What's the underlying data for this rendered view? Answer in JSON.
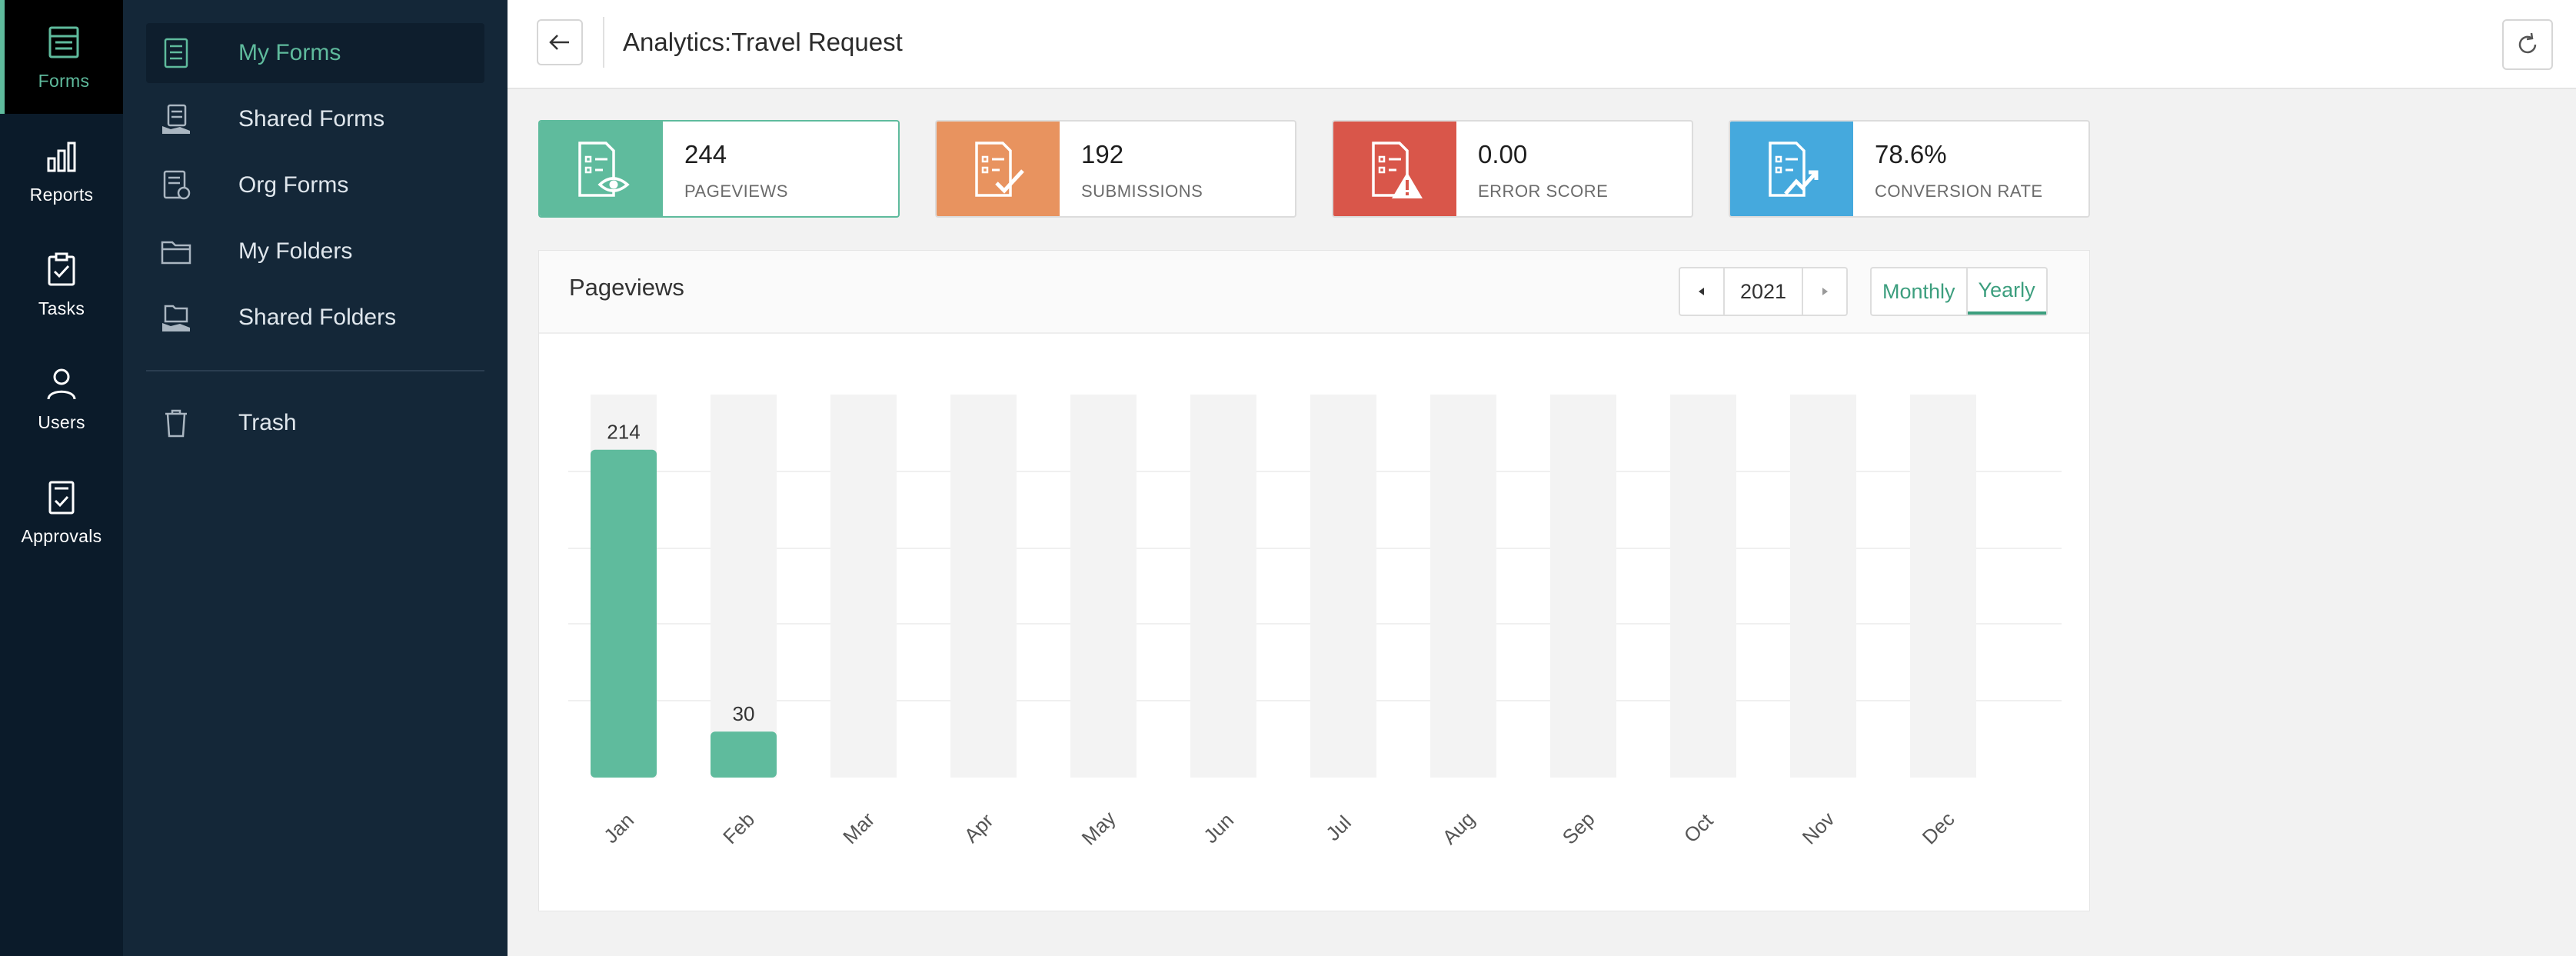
{
  "rail": [
    {
      "label": "Forms",
      "icon": "forms-icon",
      "active": true
    },
    {
      "label": "Reports",
      "icon": "reports-icon",
      "active": false
    },
    {
      "label": "Tasks",
      "icon": "tasks-icon",
      "active": false
    },
    {
      "label": "Users",
      "icon": "users-icon",
      "active": false
    },
    {
      "label": "Approvals",
      "icon": "approvals-icon",
      "active": false
    }
  ],
  "nav": [
    {
      "label": "My Forms",
      "icon": "form-doc-icon",
      "active": true
    },
    {
      "label": "Shared Forms",
      "icon": "shared-forms-icon",
      "active": false
    },
    {
      "label": "Org Forms",
      "icon": "org-forms-icon",
      "active": false
    },
    {
      "label": "My Folders",
      "icon": "folder-icon",
      "active": false
    },
    {
      "label": "Shared Folders",
      "icon": "shared-folder-icon",
      "active": false
    },
    {
      "label": "Trash",
      "icon": "trash-icon",
      "active": false
    }
  ],
  "header": {
    "title": "Analytics:Travel Request"
  },
  "stats": [
    {
      "value": "244",
      "label": "PAGEVIEWS",
      "color": "#5fbb9d",
      "icon": "pageviews-icon"
    },
    {
      "value": "192",
      "label": "SUBMISSIONS",
      "color": "#e8935f",
      "icon": "submissions-icon"
    },
    {
      "value": "0.00",
      "label": "ERROR SCORE",
      "color": "#d9564a",
      "icon": "error-score-icon"
    },
    {
      "value": "78.6%",
      "label": "CONVERSION RATE",
      "color": "#45a9dd",
      "icon": "conversion-rate-icon"
    }
  ],
  "panel": {
    "title": "Pageviews",
    "year": "2021",
    "modes": [
      "Monthly",
      "Yearly"
    ],
    "active_mode": "Yearly"
  },
  "colors": {
    "accent": "#5fbb9d",
    "bar_track": "#f3f3f3"
  },
  "chart_data": {
    "type": "bar",
    "categories": [
      "Jan",
      "Feb",
      "Mar",
      "Apr",
      "May",
      "Jun",
      "Jul",
      "Aug",
      "Sep",
      "Oct",
      "Nov",
      "Dec"
    ],
    "values": [
      214,
      30,
      0,
      0,
      0,
      0,
      0,
      0,
      0,
      0,
      0,
      0
    ],
    "data_labels": [
      "214",
      "30",
      "",
      "",
      "",
      "",
      "",
      "",
      "",
      "",
      "",
      ""
    ],
    "ylim": [
      0,
      250
    ],
    "grid": true,
    "legend": "none"
  }
}
